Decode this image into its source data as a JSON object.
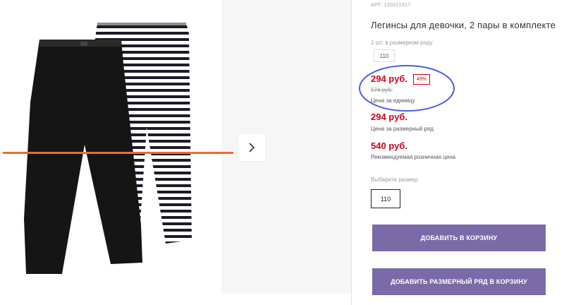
{
  "gallery": {
    "next_icon": "chevron-right-icon",
    "colors": {
      "leggings_black": "#151515",
      "stripe_dark": "#1c1c28",
      "stripe_light": "#ffffff",
      "annotation_line": "#f26b2a"
    }
  },
  "product": {
    "sku": "АРТ: 120221017",
    "title": "Легинсы для девочки, 2 пары в комплекте",
    "lot_label": "1 шт. в размерном ряду",
    "lot_size": "110",
    "unit_price": "294 руб.",
    "discount": "49%",
    "old_price": "574 руб.",
    "unit_price_caption": "Цена за единицу",
    "lot_price": "294 руб.",
    "lot_price_caption": "Цена за размерный ряд",
    "retail_price": "540 руб.",
    "retail_price_caption": "Рекомендуемая розничная цена",
    "size_label": "Выберите размер:",
    "selected_size": "110"
  },
  "actions": {
    "add_to_cart": "ДОБАВИТЬ В КОРЗИНУ",
    "add_lot_to_cart": "ДОБАВИТЬ РАЗМЕРНЫЙ РЯД В КОРЗИНУ"
  },
  "colors": {
    "price_red": "#d0021b",
    "button_purple": "#7b6aa8",
    "annotation_circle": "#4a5de0"
  }
}
